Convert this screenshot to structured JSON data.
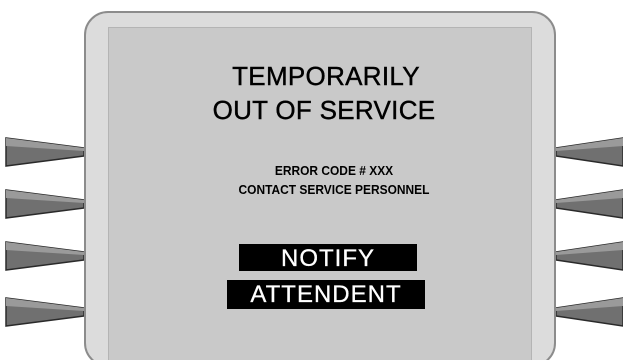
{
  "screen": {
    "title_line1": "TEMPORARILY",
    "title_line2": "OUT OF SERVICE",
    "error_line1": "ERROR CODE # XXX",
    "error_line2": "CONTACT SERVICE PERSONNEL",
    "notify_line1": "NOTIFY",
    "notify_line2": "ATTENDENT"
  },
  "function_keys": {
    "left": [
      "left-key-1",
      "left-key-2",
      "left-key-3",
      "left-key-4"
    ],
    "right": [
      "right-key-1",
      "right-key-2",
      "right-key-3",
      "right-key-4"
    ]
  },
  "colors": {
    "bezel": "#dcdcdc",
    "screen": "#c9c9c9",
    "key_fill": "#6e6e6e",
    "inverse_bg": "#000000"
  }
}
